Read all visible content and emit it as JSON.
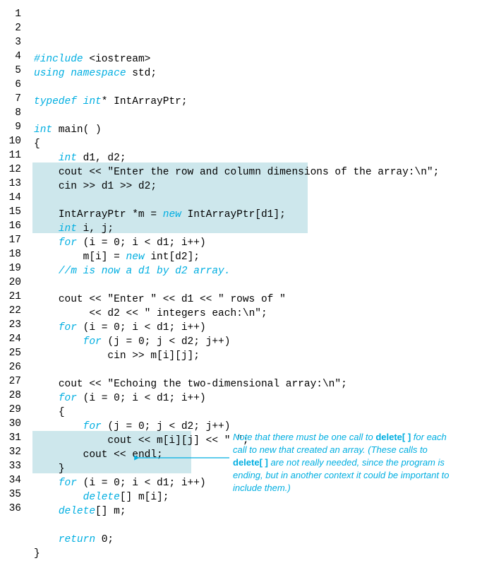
{
  "lines": [
    {
      "n": "1",
      "ind": 0,
      "parts": [
        {
          "cls": "kw",
          "t": "#include"
        },
        {
          "cls": "nm",
          "t": " <iostream>"
        }
      ]
    },
    {
      "n": "2",
      "ind": 0,
      "parts": [
        {
          "cls": "kw",
          "t": "using namespace"
        },
        {
          "cls": "nm",
          "t": " std;"
        }
      ]
    },
    {
      "n": "3",
      "ind": 0,
      "parts": []
    },
    {
      "n": "4",
      "ind": 0,
      "parts": [
        {
          "cls": "kw",
          "t": "typedef int"
        },
        {
          "cls": "nm",
          "t": "* IntArrayPtr;"
        }
      ]
    },
    {
      "n": "5",
      "ind": 0,
      "parts": []
    },
    {
      "n": "6",
      "ind": 0,
      "parts": [
        {
          "cls": "kw",
          "t": "int"
        },
        {
          "cls": "nm",
          "t": " main( )"
        }
      ]
    },
    {
      "n": "7",
      "ind": 0,
      "parts": [
        {
          "cls": "nm",
          "t": "{"
        }
      ]
    },
    {
      "n": "8",
      "ind": 1,
      "parts": [
        {
          "cls": "kw",
          "t": "int"
        },
        {
          "cls": "nm",
          "t": " d1, d2;"
        }
      ]
    },
    {
      "n": "9",
      "ind": 1,
      "parts": [
        {
          "cls": "nm",
          "t": "cout << \"Enter the row and column dimensions of the array:\\n\";"
        }
      ]
    },
    {
      "n": "10",
      "ind": 1,
      "parts": [
        {
          "cls": "nm",
          "t": "cin >> d1 >> d2;"
        }
      ]
    },
    {
      "n": "11",
      "ind": 0,
      "parts": []
    },
    {
      "n": "12",
      "ind": 1,
      "parts": [
        {
          "cls": "nm",
          "t": "IntArrayPtr *m = "
        },
        {
          "cls": "kw",
          "t": "new"
        },
        {
          "cls": "nm",
          "t": " IntArrayPtr[d1];"
        }
      ]
    },
    {
      "n": "13",
      "ind": 1,
      "parts": [
        {
          "cls": "kw",
          "t": "int"
        },
        {
          "cls": "nm",
          "t": " i, j;"
        }
      ]
    },
    {
      "n": "14",
      "ind": 1,
      "parts": [
        {
          "cls": "kw",
          "t": "for"
        },
        {
          "cls": "nm",
          "t": " (i = 0; i < d1; i++)"
        }
      ]
    },
    {
      "n": "15",
      "ind": 2,
      "parts": [
        {
          "cls": "nm",
          "t": "m[i] = "
        },
        {
          "cls": "kw",
          "t": "new"
        },
        {
          "cls": "nm",
          "t": " int[d2];"
        }
      ]
    },
    {
      "n": "16",
      "ind": 1,
      "parts": [
        {
          "cls": "cm",
          "t": "//m is now a d1 by d2 array."
        }
      ]
    },
    {
      "n": "17",
      "ind": 0,
      "parts": []
    },
    {
      "n": "18",
      "ind": 1,
      "parts": [
        {
          "cls": "nm",
          "t": "cout << \"Enter \" << d1 << \" rows of \""
        }
      ]
    },
    {
      "n": "19",
      "ind": 2,
      "parts": [
        {
          "cls": "nm",
          "t": " << d2 << \" integers each:\\n\";"
        }
      ]
    },
    {
      "n": "20",
      "ind": 1,
      "parts": [
        {
          "cls": "kw",
          "t": "for"
        },
        {
          "cls": "nm",
          "t": " (i = 0; i < d1; i++)"
        }
      ]
    },
    {
      "n": "21",
      "ind": 2,
      "parts": [
        {
          "cls": "kw",
          "t": "for"
        },
        {
          "cls": "nm",
          "t": " (j = 0; j < d2; j++)"
        }
      ]
    },
    {
      "n": "22",
      "ind": 3,
      "parts": [
        {
          "cls": "nm",
          "t": "cin >> m[i][j];"
        }
      ]
    },
    {
      "n": "23",
      "ind": 0,
      "parts": []
    },
    {
      "n": "24",
      "ind": 1,
      "parts": [
        {
          "cls": "nm",
          "t": "cout << \"Echoing the two-dimensional array:\\n\";"
        }
      ]
    },
    {
      "n": "25",
      "ind": 1,
      "parts": [
        {
          "cls": "kw",
          "t": "for"
        },
        {
          "cls": "nm",
          "t": " (i = 0; i < d1; i++)"
        }
      ]
    },
    {
      "n": "26",
      "ind": 1,
      "parts": [
        {
          "cls": "nm",
          "t": "{"
        }
      ]
    },
    {
      "n": "27",
      "ind": 2,
      "parts": [
        {
          "cls": "kw",
          "t": "for"
        },
        {
          "cls": "nm",
          "t": " (j = 0; j < d2; j++)"
        }
      ]
    },
    {
      "n": "28",
      "ind": 3,
      "parts": [
        {
          "cls": "nm",
          "t": "cout << m[i][j] << \" \";"
        }
      ]
    },
    {
      "n": "29",
      "ind": 2,
      "parts": [
        {
          "cls": "nm",
          "t": "cout << endl;"
        }
      ]
    },
    {
      "n": "30",
      "ind": 1,
      "parts": [
        {
          "cls": "nm",
          "t": "}"
        }
      ]
    },
    {
      "n": "31",
      "ind": 1,
      "parts": [
        {
          "cls": "kw",
          "t": "for"
        },
        {
          "cls": "nm",
          "t": " (i = 0; i < d1; i++)"
        }
      ]
    },
    {
      "n": "32",
      "ind": 2,
      "parts": [
        {
          "cls": "kw",
          "t": "delete"
        },
        {
          "cls": "nm",
          "t": "[] m[i];"
        }
      ]
    },
    {
      "n": "33",
      "ind": 1,
      "parts": [
        {
          "cls": "kw",
          "t": "delete"
        },
        {
          "cls": "nm",
          "t": "[] m;"
        }
      ]
    },
    {
      "n": "34",
      "ind": 0,
      "parts": []
    },
    {
      "n": "35",
      "ind": 1,
      "parts": [
        {
          "cls": "kw",
          "t": "return"
        },
        {
          "cls": "nm",
          "t": " 0;"
        }
      ]
    },
    {
      "n": "36",
      "ind": 0,
      "parts": [
        {
          "cls": "nm",
          "t": "}"
        }
      ]
    }
  ],
  "annotation": {
    "p1a": "Note that there must be one call to ",
    "p1b": "delete[ ]",
    "p2": " for each call to new that created an array. (These calls to ",
    "p2b": "delete[ ]",
    "p3": " are not really needed, since the program is ending, but in another context it could be important to include them.)"
  }
}
